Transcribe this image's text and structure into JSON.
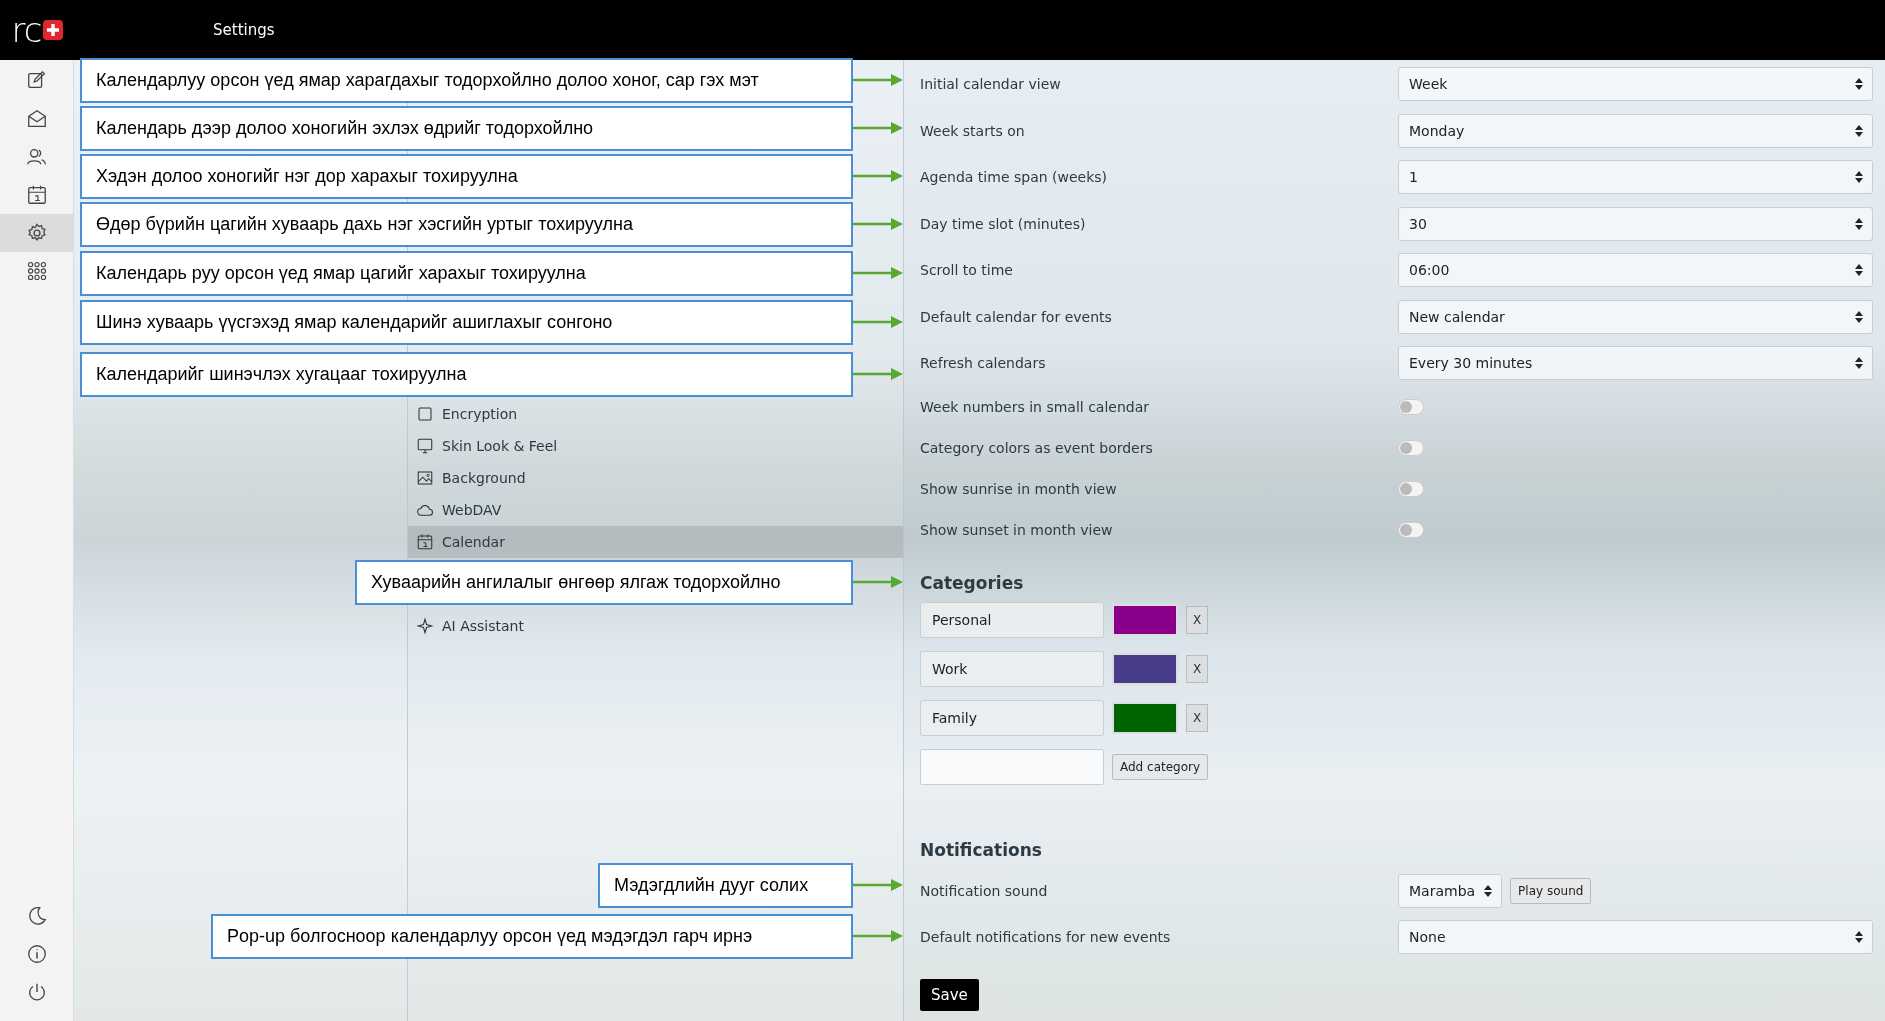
{
  "header": {
    "logo": "rc",
    "title": "Settings"
  },
  "rail": [
    {
      "kind": "compose",
      "selected": false
    },
    {
      "kind": "mail",
      "selected": false
    },
    {
      "kind": "contacts",
      "selected": false
    },
    {
      "kind": "calendar",
      "selected": false
    },
    {
      "kind": "settings",
      "selected": true
    },
    {
      "kind": "apps",
      "selected": false
    }
  ],
  "rail_bottom": [
    {
      "kind": "moon"
    },
    {
      "kind": "info"
    },
    {
      "kind": "power"
    }
  ],
  "sections": [
    {
      "label": "Encryption",
      "kind": "square",
      "selected": false
    },
    {
      "label": "Skin Look & Feel",
      "kind": "monitor",
      "selected": false
    },
    {
      "label": "Background",
      "kind": "image",
      "selected": false
    },
    {
      "label": "WebDAV",
      "kind": "cloud",
      "selected": false
    },
    {
      "label": "Calendar",
      "kind": "calendar",
      "selected": true
    },
    {
      "label": "AI Assistant",
      "kind": "sparkle",
      "selected": false
    }
  ],
  "settings": [
    {
      "label": "Initial calendar view",
      "kind": "select",
      "value": "Week"
    },
    {
      "label": "Week starts on",
      "kind": "select",
      "value": "Monday"
    },
    {
      "label": "Agenda time span (weeks)",
      "kind": "select",
      "value": "1"
    },
    {
      "label": "Day time slot (minutes)",
      "kind": "select",
      "value": "30"
    },
    {
      "label": "Scroll to time",
      "kind": "select",
      "value": "06:00"
    },
    {
      "label": "Default calendar for events",
      "kind": "select",
      "value": "New calendar"
    },
    {
      "label": "Refresh calendars",
      "kind": "select",
      "value": "Every 30 minutes"
    },
    {
      "label": "Week numbers in small calendar",
      "kind": "toggle",
      "on": false
    },
    {
      "label": "Category colors as event borders",
      "kind": "toggle",
      "on": false
    },
    {
      "label": "Show sunrise in month view",
      "kind": "toggle",
      "on": false
    },
    {
      "label": "Show sunset in month view",
      "kind": "toggle",
      "on": false
    }
  ],
  "categories": {
    "title": "Categories",
    "items": [
      {
        "name": "Personal",
        "color": "#8b008b",
        "remove": "X"
      },
      {
        "name": "Work",
        "color": "#483d8b",
        "remove": "X"
      },
      {
        "name": "Family",
        "color": "#006400",
        "remove": "X"
      }
    ],
    "add_button": "Add category"
  },
  "notifications": {
    "title": "Notifications",
    "rows": [
      {
        "label": "Notification sound",
        "kind": "sound",
        "value": "Maramba",
        "button": "Play sound"
      },
      {
        "label": "Default notifications for new events",
        "kind": "select",
        "value": "None"
      }
    ]
  },
  "save": "Save",
  "callouts": [
    {
      "text": "Календарлуу орсон үед ямар харагдахыг тодорхойлно долоо хоног, сар гэх мэт"
    },
    {
      "text": "Календарь дээр долоо хоногийн эхлэх өдрийг тодорхойлно"
    },
    {
      "text": "Хэдэн долоо хоногийг нэг дор харахыг тохируулна"
    },
    {
      "text": "Өдөр бүрийн цагийн хуваарь дахь нэг хэсгийн уртыг тохируулна"
    },
    {
      "text": "Календарь руу орсон үед ямар цагийг харахыг тохируулна"
    },
    {
      "text": "Шинэ хуваарь үүсгэхэд ямар календарийг ашиглахыг сонгоно"
    },
    {
      "text": "Календарийг шинэчлэх хугацааг тохируулна"
    },
    {
      "text": "Хуваарийн ангилалыг өнгөөр ялгаж тодорхойлно"
    },
    {
      "text": "Мэдэгдлийн дууг солих"
    },
    {
      "text": "Pop-up болгосноор календарлуу орсон үед мэдэгдэл гарч ирнэ"
    }
  ]
}
